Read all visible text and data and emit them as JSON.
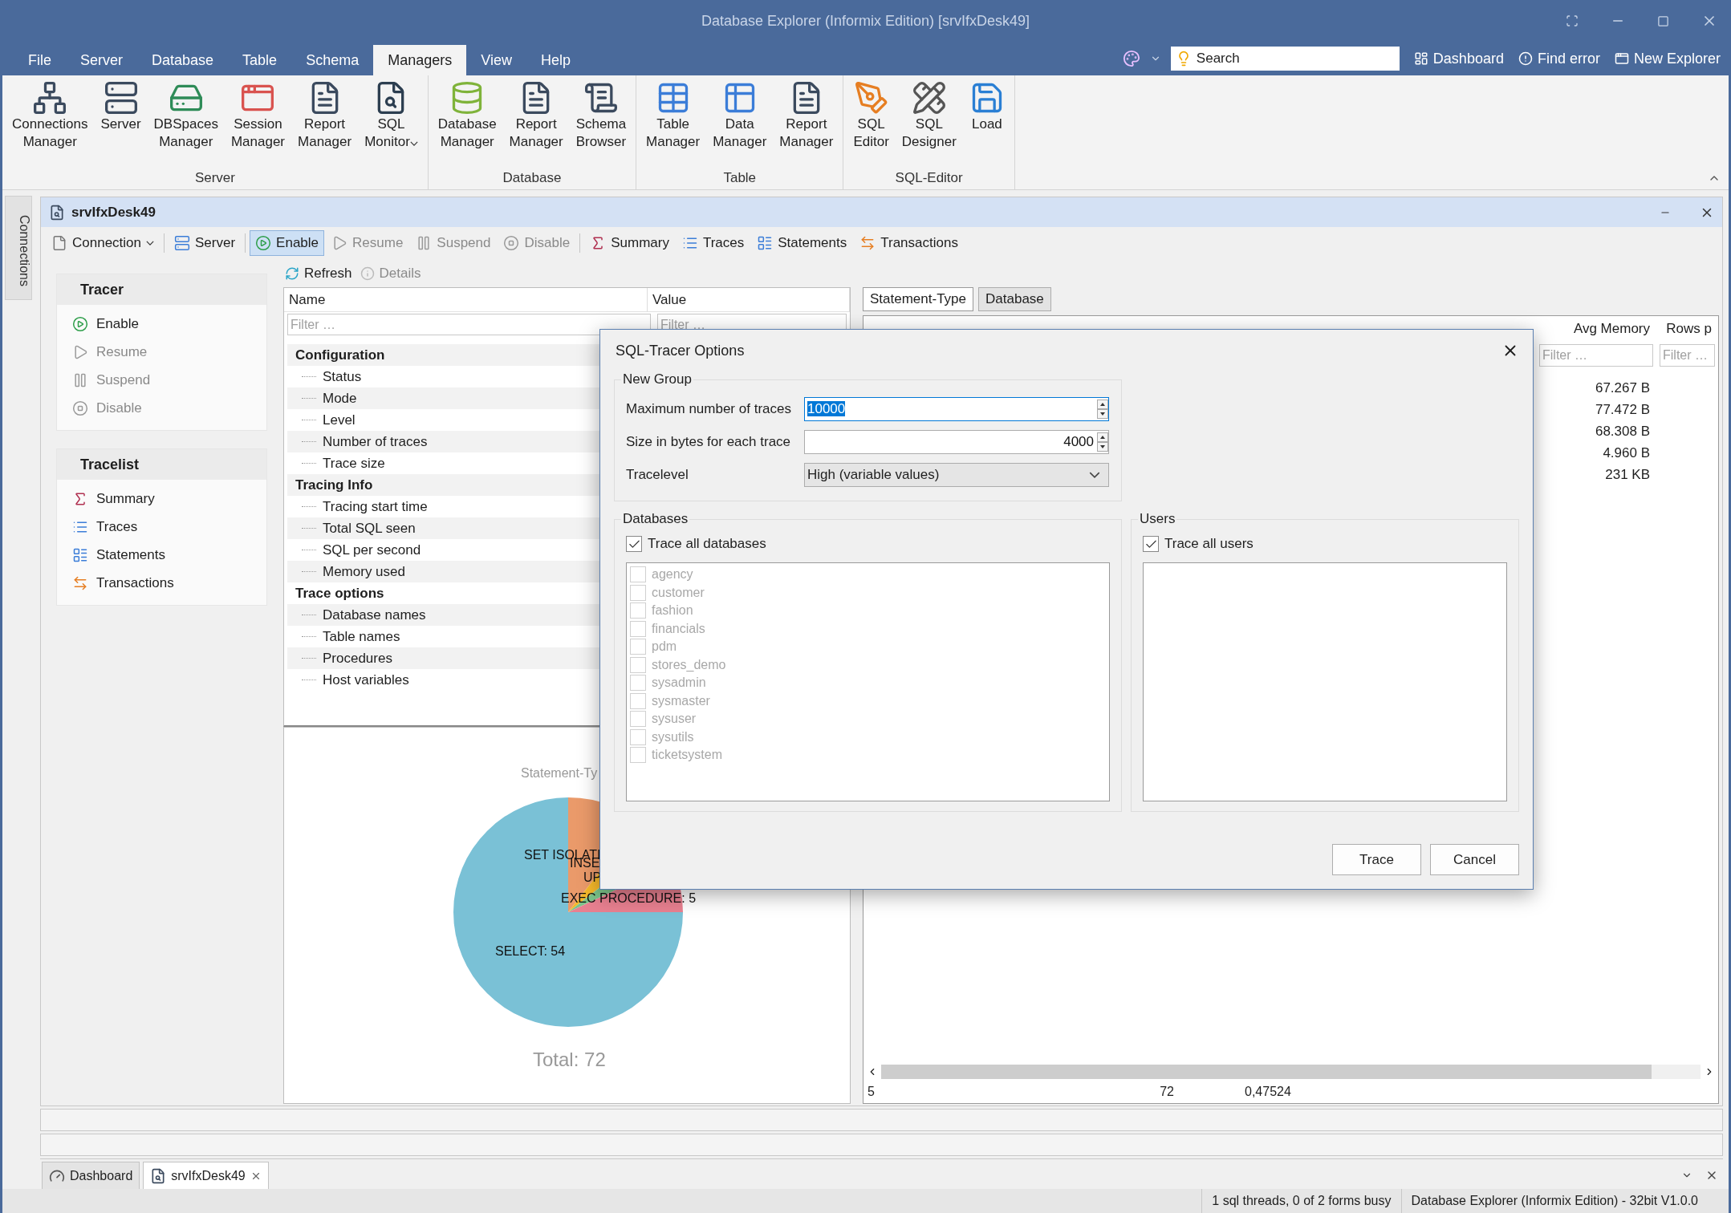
{
  "window": {
    "title": "Database Explorer (Informix Edition) [srvIfxDesk49]"
  },
  "menu": [
    {
      "label": "File",
      "selected": false
    },
    {
      "label": "Server",
      "selected": false
    },
    {
      "label": "Database",
      "selected": false
    },
    {
      "label": "Table",
      "selected": false
    },
    {
      "label": "Schema",
      "selected": false
    },
    {
      "label": "Managers",
      "selected": true
    },
    {
      "label": "View",
      "selected": false
    },
    {
      "label": "Help",
      "selected": false
    }
  ],
  "quick_access": {
    "search": {
      "placeholder": "Search"
    },
    "links": [
      "Dashboard",
      "Find error",
      "New Explorer"
    ]
  },
  "ribbon": [
    {
      "group": "Server",
      "buttons": [
        {
          "lines": [
            "Connections",
            "Manager"
          ],
          "dropdown": false
        },
        {
          "lines": [
            "Server"
          ],
          "dropdown": false
        },
        {
          "lines": [
            "DBSpaces",
            "Manager"
          ],
          "dropdown": false
        },
        {
          "lines": [
            "Session",
            "Manager"
          ],
          "dropdown": false
        },
        {
          "lines": [
            "Report",
            "Manager"
          ],
          "dropdown": false
        },
        {
          "lines": [
            "SQL",
            "Monitor"
          ],
          "dropdown": true
        }
      ]
    },
    {
      "group": "Database",
      "buttons": [
        {
          "lines": [
            "Database",
            "Manager"
          ],
          "dropdown": false
        },
        {
          "lines": [
            "Report",
            "Manager"
          ],
          "dropdown": false
        },
        {
          "lines": [
            "Schema",
            "Browser"
          ],
          "dropdown": false
        }
      ]
    },
    {
      "group": "Table",
      "buttons": [
        {
          "lines": [
            "Table",
            "Manager"
          ],
          "dropdown": false
        },
        {
          "lines": [
            "Data",
            "Manager"
          ],
          "dropdown": false
        },
        {
          "lines": [
            "Report",
            "Manager"
          ],
          "dropdown": false
        }
      ]
    },
    {
      "group": "SQL-Editor",
      "buttons": [
        {
          "lines": [
            "SQL",
            "Editor"
          ],
          "dropdown": false
        },
        {
          "lines": [
            "SQL",
            "Designer"
          ],
          "dropdown": false
        },
        {
          "lines": [
            "Load"
          ],
          "dropdown": false
        }
      ]
    }
  ],
  "side_tab": "Connections",
  "document": {
    "title": "srvIfxDesk49",
    "toolbar": [
      {
        "label": "Connection",
        "dropdown": true,
        "selected": false,
        "disabled": false
      },
      {
        "label": "Server",
        "dropdown": false,
        "selected": false,
        "disabled": false
      },
      {
        "label": "Enable",
        "dropdown": false,
        "selected": true,
        "disabled": false
      },
      {
        "label": "Resume",
        "dropdown": false,
        "selected": false,
        "disabled": true
      },
      {
        "label": "Suspend",
        "dropdown": false,
        "selected": false,
        "disabled": true
      },
      {
        "label": "Disable",
        "dropdown": false,
        "selected": false,
        "disabled": true
      },
      {
        "label": "Summary",
        "dropdown": false,
        "selected": false,
        "disabled": false
      },
      {
        "label": "Traces",
        "dropdown": false,
        "selected": false,
        "disabled": false
      },
      {
        "label": "Statements",
        "dropdown": false,
        "selected": false,
        "disabled": false
      },
      {
        "label": "Transactions",
        "dropdown": false,
        "selected": false,
        "disabled": false
      }
    ],
    "actions": [
      {
        "label": "Refresh",
        "disabled": false
      },
      {
        "label": "Details",
        "disabled": true
      }
    ]
  },
  "nav": [
    {
      "title": "Tracer",
      "items": [
        {
          "label": "Enable",
          "disabled": false
        },
        {
          "label": "Resume",
          "disabled": true
        },
        {
          "label": "Suspend",
          "disabled": true
        },
        {
          "label": "Disable",
          "disabled": true
        }
      ]
    },
    {
      "title": "Tracelist",
      "items": [
        {
          "label": "Summary",
          "disabled": false
        },
        {
          "label": "Traces",
          "disabled": false
        },
        {
          "label": "Statements",
          "disabled": false
        },
        {
          "label": "Transactions",
          "disabled": false
        }
      ]
    }
  ],
  "properties": {
    "columns": [
      "Name",
      "Value"
    ],
    "filters": [
      {
        "placeholder": "Filter …"
      },
      {
        "placeholder": "Filter …"
      }
    ],
    "groups": [
      {
        "label": "Configuration",
        "children": [
          {
            "label": "Status"
          },
          {
            "label": "Mode"
          },
          {
            "label": "Level"
          },
          {
            "label": "Number of traces"
          },
          {
            "label": "Trace size"
          }
        ]
      },
      {
        "label": "Tracing Info",
        "children": [
          {
            "label": "Tracing start time"
          },
          {
            "label": "Total SQL seen"
          },
          {
            "label": "SQL per second"
          },
          {
            "label": "Memory used"
          }
        ]
      },
      {
        "label": "Trace options",
        "children": [
          {
            "label": "Database names"
          },
          {
            "label": "Table names"
          },
          {
            "label": "Procedures"
          },
          {
            "label": "Host variables"
          }
        ]
      }
    ]
  },
  "chart": {
    "title": "Statement-Ty",
    "labels": [
      "SET ISOLATI",
      "INSE",
      "UP",
      "EXEC PROCEDURE: 5",
      "SELECT: 54"
    ],
    "total": "Total: 72"
  },
  "results": {
    "tabs": [
      {
        "label": "Statement-Type",
        "selected": true
      },
      {
        "label": "Database",
        "selected": false
      }
    ],
    "columns": [
      "Avg Memory",
      "Rows p"
    ],
    "filters": [
      {
        "placeholder": "Filter …"
      },
      {
        "placeholder": "Filter …"
      }
    ],
    "rows": [
      {
        "avg_memory": "67.267 B"
      },
      {
        "avg_memory": "77.472 B"
      },
      {
        "avg_memory": "68.308 B"
      },
      {
        "avg_memory": "4.960 B"
      },
      {
        "avg_memory": "231 KB"
      }
    ],
    "footer": [
      "5",
      "72",
      "0,47524"
    ]
  },
  "bottom_tabs": [
    {
      "label": "Dashboard",
      "selected": false,
      "closable": false
    },
    {
      "label": "srvIfxDesk49",
      "selected": true,
      "closable": true
    }
  ],
  "status_bar": [
    "1 sql threads, 0 of 2 forms busy",
    "Database Explorer (Informix Edition) - 32bit V1.0.0"
  ],
  "dialog": {
    "title": "SQL-Tracer Options",
    "new_group": {
      "title": "New Group",
      "fields": [
        {
          "kind": "spin",
          "label": "Maximum number of traces",
          "value": "10000",
          "highlighted": true
        },
        {
          "kind": "spin",
          "label": "Size in bytes for each trace",
          "value": "4000",
          "highlighted": false
        },
        {
          "kind": "select",
          "label": "Tracelevel",
          "value": "High (variable values)"
        }
      ]
    },
    "databases": {
      "title": "Databases",
      "all": {
        "label": "Trace all databases",
        "checked": true
      },
      "items": [
        {
          "label": "agency",
          "checked": false,
          "disabled": true
        },
        {
          "label": "customer",
          "checked": false,
          "disabled": true
        },
        {
          "label": "fashion",
          "checked": false,
          "disabled": true
        },
        {
          "label": "financials",
          "checked": false,
          "disabled": true
        },
        {
          "label": "pdm",
          "checked": false,
          "disabled": true
        },
        {
          "label": "stores_demo",
          "checked": false,
          "disabled": true
        },
        {
          "label": "sysadmin",
          "checked": false,
          "disabled": true
        },
        {
          "label": "sysmaster",
          "checked": false,
          "disabled": true
        },
        {
          "label": "sysuser",
          "checked": false,
          "disabled": true
        },
        {
          "label": "sysutils",
          "checked": false,
          "disabled": true
        },
        {
          "label": "ticketsystem",
          "checked": false,
          "disabled": true
        }
      ]
    },
    "users": {
      "title": "Users",
      "all": {
        "label": "Trace all users",
        "checked": true
      }
    },
    "buttons": [
      "Trace",
      "Cancel"
    ]
  }
}
